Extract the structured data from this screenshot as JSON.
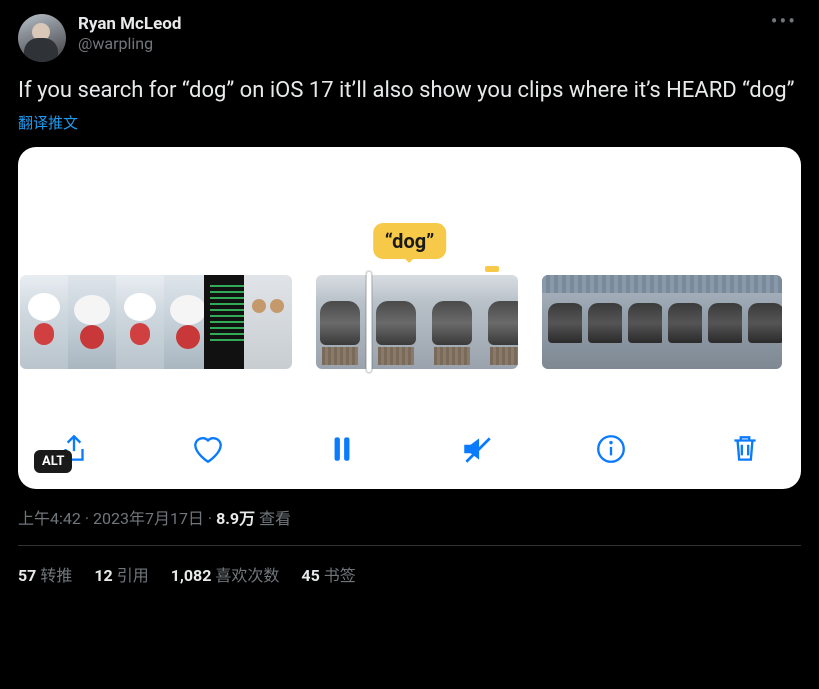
{
  "author": {
    "display_name": "Ryan McLeod",
    "handle": "@warpling"
  },
  "body": "If you search for “dog” on iOS 17 it’ll also show you clips where it’s HEARD “dog”",
  "translate_label": "翻译推文",
  "media": {
    "tooltip": "“dog”",
    "alt_badge": "ALT"
  },
  "meta": {
    "time": "上午4:42",
    "dot1": " · ",
    "date": "2023年7月17日",
    "dot2": " · ",
    "views_count": "8.9万",
    "views_label": " 查看"
  },
  "stats": {
    "retweets_count": "57",
    "retweets_label": "转推",
    "quotes_count": "12",
    "quotes_label": "引用",
    "likes_count": "1,082",
    "likes_label": "喜欢次数",
    "bookmarks_count": "45",
    "bookmarks_label": "书签"
  }
}
